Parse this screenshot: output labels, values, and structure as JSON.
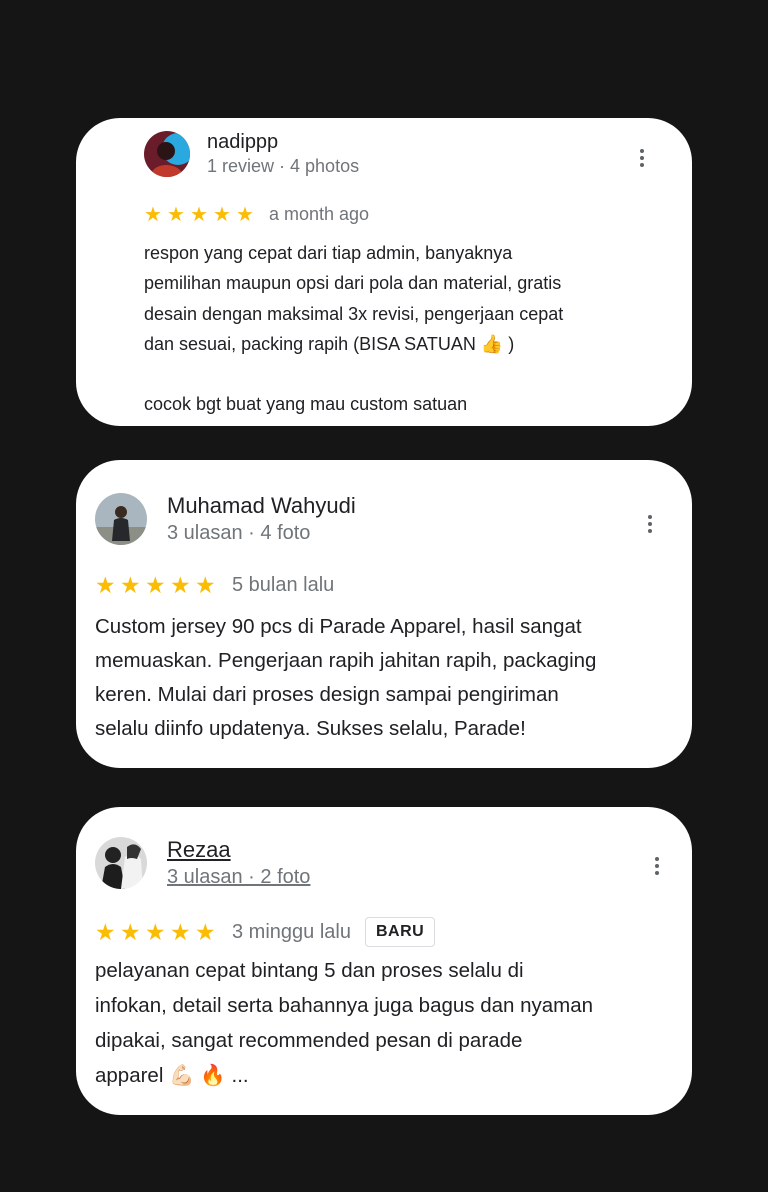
{
  "colors": {
    "background": "#151515",
    "card": "#ffffff",
    "star": "#fbbc04",
    "secondary_text": "#70757a",
    "primary_text": "#202124"
  },
  "reviews": [
    {
      "author": "nadippp",
      "meta": "1 review · 4 photos",
      "rating": 5,
      "star_glyph": "★",
      "time": "a month ago",
      "lines": [
        "respon yang cepat dari tiap admin, banyaknya",
        "pemilihan maupun opsi dari pola dan material, gratis",
        "desain dengan maksimal 3x revisi, pengerjaan cepat",
        "dan sesuai, packing rapih (BISA SATUAN 👍 )",
        "",
        "cocok bgt buat yang mau custom satuan"
      ]
    },
    {
      "author": "Muhamad Wahyudi",
      "meta": "3 ulasan · 4 foto",
      "rating": 5,
      "star_glyph": "★",
      "time": "5 bulan lalu",
      "lines": [
        "Custom jersey 90 pcs di Parade Apparel, hasil sangat",
        "memuaskan. Pengerjaan rapih jahitan rapih, packaging",
        "keren. Mulai dari proses design sampai pengiriman",
        "selalu diinfo updatenya. Sukses selalu, Parade!"
      ]
    },
    {
      "author": "Rezaa",
      "meta": "3 ulasan · 2 foto",
      "rating": 5,
      "star_glyph": "★",
      "time": "3 minggu lalu",
      "badge": "BARU",
      "lines": [
        "pelayanan cepat bintang 5 dan proses selalu di",
        "infokan, detail serta bahannya juga bagus dan nyaman",
        "dipakai, sangat recommended pesan di parade",
        "apparel 💪🏻 🔥 ..."
      ]
    }
  ]
}
